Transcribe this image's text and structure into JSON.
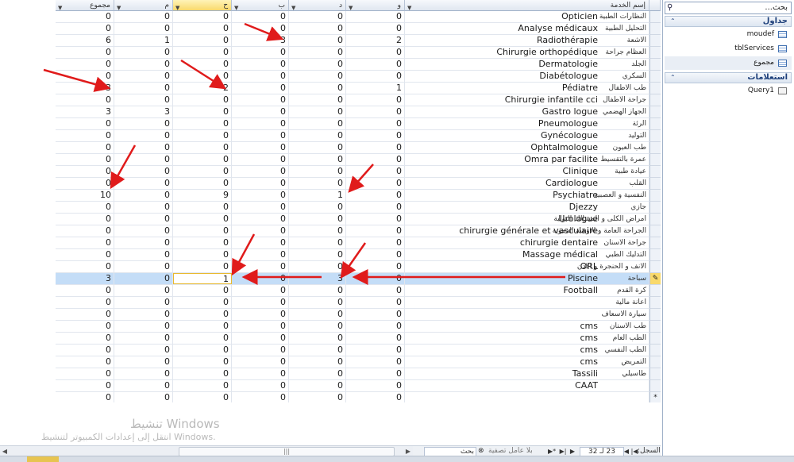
{
  "columns": {
    "service": "إسم الخدمة",
    "w": "و",
    "d": "د",
    "b": "ب",
    "h": "ح",
    "m": "م",
    "total": "مجموع"
  },
  "rows": [
    {
      "fr": "Opticien",
      "ar": "النظارات الطبية",
      "w": "0",
      "d": "0",
      "b": "0",
      "h": "0",
      "m": "0",
      "total": "0"
    },
    {
      "fr": "Analyse médicaux",
      "ar": "التحليل الطبية",
      "w": "0",
      "d": "0",
      "b": "0",
      "h": "0",
      "m": "0",
      "total": "0"
    },
    {
      "fr": "Radiothérapie",
      "ar": "الاشعة",
      "w": "2",
      "d": "0",
      "b": "3",
      "h": "0",
      "m": "1",
      "total": "6"
    },
    {
      "fr": "Chirurgie orthopédique",
      "ar": "العظام جراحة",
      "w": "0",
      "d": "0",
      "b": "0",
      "h": "0",
      "m": "0",
      "total": "0"
    },
    {
      "fr": "Dermatologie",
      "ar": "الجلد",
      "w": "0",
      "d": "0",
      "b": "0",
      "h": "0",
      "m": "0",
      "total": "0"
    },
    {
      "fr": "Diabétologue",
      "ar": "السكري",
      "w": "0",
      "d": "0",
      "b": "0",
      "h": "0",
      "m": "0",
      "total": "0"
    },
    {
      "fr": "Pédiatre",
      "ar": "طب الاطفال",
      "w": "1",
      "d": "0",
      "b": "0",
      "h": "2",
      "m": "0",
      "total": "3"
    },
    {
      "fr": "Chirurgie infantile cci",
      "ar": "جراحة الاطفال",
      "w": "0",
      "d": "0",
      "b": "0",
      "h": "0",
      "m": "0",
      "total": "0"
    },
    {
      "fr": "Gastro logue",
      "ar": "الجهاز الهضمي",
      "w": "0",
      "d": "0",
      "b": "0",
      "h": "0",
      "m": "3",
      "total": "3"
    },
    {
      "fr": "Pneumologue",
      "ar": "الرئة",
      "w": "0",
      "d": "0",
      "b": "0",
      "h": "0",
      "m": "0",
      "total": "0"
    },
    {
      "fr": "Gynécologue",
      "ar": "التوليد",
      "w": "0",
      "d": "0",
      "b": "0",
      "h": "0",
      "m": "0",
      "total": "0"
    },
    {
      "fr": "Ophtalmologue",
      "ar": "طب العيون",
      "w": "0",
      "d": "0",
      "b": "0",
      "h": "0",
      "m": "0",
      "total": "0"
    },
    {
      "fr": "Omra par facilite",
      "ar": "عمرة بالتقسيط",
      "w": "0",
      "d": "0",
      "b": "0",
      "h": "0",
      "m": "0",
      "total": "0"
    },
    {
      "fr": "Clinique",
      "ar": "عيادة طبية",
      "w": "0",
      "d": "0",
      "b": "0",
      "h": "0",
      "m": "0",
      "total": "0"
    },
    {
      "fr": "Cardiologue",
      "ar": "القلب",
      "w": "0",
      "d": "0",
      "b": "0",
      "h": "0",
      "m": "0",
      "total": "0"
    },
    {
      "fr": "Psychiatre",
      "ar": "النفسية و العصبية",
      "w": "0",
      "d": "1",
      "b": "0",
      "h": "9",
      "m": "0",
      "total": "10"
    },
    {
      "fr": "Djezzy",
      "ar": "جازي",
      "w": "0",
      "d": "0",
      "b": "0",
      "h": "0",
      "m": "0",
      "total": "0"
    },
    {
      "fr": "Urologue",
      "ar": "امراض الكلى و المسالك البولية",
      "w": "0",
      "d": "0",
      "b": "0",
      "h": "0",
      "m": "0",
      "total": "0"
    },
    {
      "fr": "chirurgie générale et vasculaire",
      "ar": "الجراحة العامة و الاوعية الدموية",
      "w": "0",
      "d": "0",
      "b": "0",
      "h": "0",
      "m": "0",
      "total": "0"
    },
    {
      "fr": "chirurgie dentaire",
      "ar": "جراحة الاسنان",
      "w": "0",
      "d": "0",
      "b": "0",
      "h": "0",
      "m": "0",
      "total": "0"
    },
    {
      "fr": "Massage médical",
      "ar": "التدليك الطبي",
      "w": "0",
      "d": "0",
      "b": "0",
      "h": "0",
      "m": "0",
      "total": "0"
    },
    {
      "fr": "ORL",
      "ar": "الانف و الحنجرة و الاذن",
      "w": "0",
      "d": "0",
      "b": "0",
      "h": "0",
      "m": "0",
      "total": "0"
    },
    {
      "fr": "Piscine",
      "ar": "سباحة",
      "w": "0",
      "d": "3",
      "b": "0",
      "h": "1",
      "m": "0",
      "total": "3"
    },
    {
      "fr": "Football",
      "ar": "كرة القدم",
      "w": "0",
      "d": "0",
      "b": "0",
      "h": "0",
      "m": "0",
      "total": "0"
    },
    {
      "fr": "",
      "ar": "اعانة مالية",
      "w": "0",
      "d": "0",
      "b": "0",
      "h": "0",
      "m": "0",
      "total": "0"
    },
    {
      "fr": "",
      "ar": "سيارة الاسعاف",
      "w": "0",
      "d": "0",
      "b": "0",
      "h": "0",
      "m": "0",
      "total": "0"
    },
    {
      "fr": "cms",
      "ar": "طب الاسنان",
      "w": "0",
      "d": "0",
      "b": "0",
      "h": "0",
      "m": "0",
      "total": "0"
    },
    {
      "fr": "cms",
      "ar": "الطب العام",
      "w": "0",
      "d": "0",
      "b": "0",
      "h": "0",
      "m": "0",
      "total": "0"
    },
    {
      "fr": "cms",
      "ar": "الطب النفسي",
      "w": "0",
      "d": "0",
      "b": "0",
      "h": "0",
      "m": "0",
      "total": "0"
    },
    {
      "fr": "cms",
      "ar": "التمريض",
      "w": "0",
      "d": "0",
      "b": "0",
      "h": "0",
      "m": "0",
      "total": "0"
    },
    {
      "fr": "Tassili",
      "ar": "طاسيلي",
      "w": "0",
      "d": "0",
      "b": "0",
      "h": "0",
      "m": "0",
      "total": "0"
    },
    {
      "fr": "CAAT",
      "ar": "",
      "w": "0",
      "d": "0",
      "b": "0",
      "h": "0",
      "m": "0",
      "total": "0"
    },
    {
      "fr": "",
      "ar": "",
      "w": "0",
      "d": "0",
      "b": "0",
      "h": "0",
      "m": "0",
      "total": "0"
    }
  ],
  "new_record_marker": "*",
  "watermark": {
    "title": "تنشيط Windows",
    "subtitle": "انتقل إلى إعدادات الكمبيوتر لتنشيط Windows."
  },
  "navbar": {
    "record_label": "السجل:",
    "record_position": "23 لـ 32",
    "filter_label": "بلا عامل تصفية",
    "search_label": "بحث"
  },
  "navpane": {
    "search_text": "بحث...",
    "group_tables": "جداول",
    "tables": [
      "moudef",
      "tblServices",
      "مجموع"
    ],
    "group_queries": "استعلامات",
    "queries": [
      "Query1"
    ]
  },
  "icons": [
    "search-icon",
    "chevron-up-icon",
    "table-icon",
    "query-icon",
    "pencil-icon",
    "dropdown-arrow-icon"
  ]
}
